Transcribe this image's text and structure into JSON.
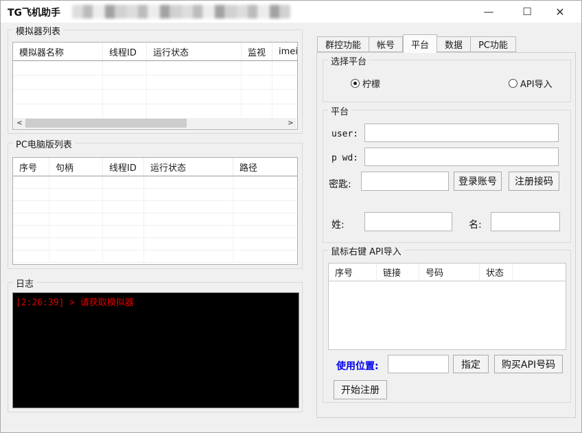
{
  "window": {
    "title": "TG飞机助手",
    "controls": {
      "minimize": "—",
      "maximize": "☐",
      "close": "✕"
    }
  },
  "left_panel": {
    "emulator_group": {
      "title": "模拟器列表",
      "columns": [
        "模拟器名称",
        "线程ID",
        "运行状态",
        "监视",
        "imei"
      ],
      "scroll_left": "<",
      "scroll_right": ">"
    },
    "pc_group": {
      "title": "PC电脑版列表",
      "columns": [
        "序号",
        "句柄",
        "线程ID",
        "运行状态",
        "路径"
      ]
    },
    "log_group": {
      "title": "日志",
      "entries": [
        "[2:26:39] > 请获取模拟器"
      ],
      "text_color": "#e00000",
      "background": "#000000"
    }
  },
  "right_panel": {
    "tabs": [
      "群控功能",
      "帐号",
      "平台",
      "数据",
      "PC功能"
    ],
    "active_tab": "平台",
    "select_platform_group": {
      "title": "选择平台",
      "radio_lemon": "柠檬",
      "radio_api": "API导入",
      "selected": "柠檬"
    },
    "platform_group": {
      "title": "平台",
      "user_label": "user:",
      "pwd_label": "p wd:",
      "key_label": "密匙:",
      "login_button": "登录账号",
      "register_sms_button": "注册接码",
      "surname_label": "姓:",
      "givenname_label": "名:"
    },
    "api_group": {
      "title": "鼠标右键 API导入",
      "columns": [
        "序号",
        "链接",
        "号码",
        "状态"
      ],
      "use_position_label": "使用位置:",
      "use_position_color": "#0000ee",
      "assign_button": "指定",
      "buy_api_button": "购买API号码",
      "start_register_button": "开始注册"
    }
  }
}
